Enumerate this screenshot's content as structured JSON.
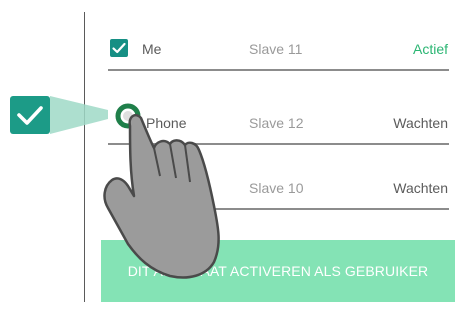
{
  "devices": [
    {
      "name": "Me",
      "slave": "Slave 11",
      "status": "Actief",
      "checked": true
    },
    {
      "name": "Phone",
      "slave": "Slave 12",
      "status": "Wachten",
      "checked": false
    },
    {
      "name": "",
      "slave": "Slave 10",
      "status": "Wachten",
      "checked": false
    }
  ],
  "activate_button_label": "DIT APPARAAT ACTIVEREN ALS GEBRUIKER",
  "colors": {
    "checkbox": "#168f84",
    "active_status": "#2bb673",
    "button": "#84e3b5",
    "callout": "#9fd9c7"
  },
  "icons": {
    "callout_checkbox": "check-icon",
    "pointer": "tapping-hand-icon"
  }
}
